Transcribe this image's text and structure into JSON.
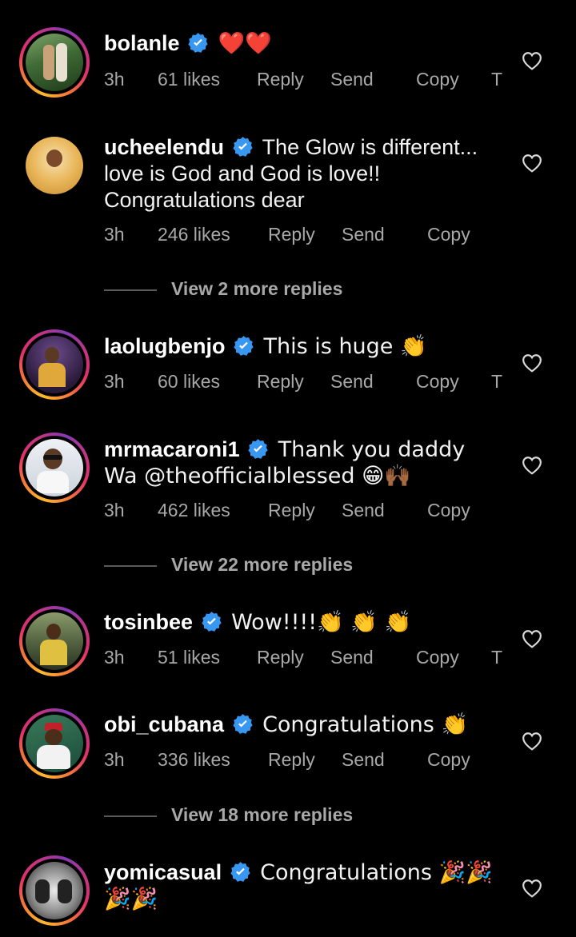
{
  "comments": [
    {
      "username": "bolanle",
      "text": "❤️❤️",
      "time": "3h",
      "likes": "61 likes",
      "reply": "Reply",
      "send": "Send",
      "copy": "Copy",
      "extra": "T",
      "avatar_color": "#2f5a2a"
    },
    {
      "username": "ucheelendu",
      "text": "The Glow is different... love is God and God is love!! Congratulations dear",
      "time": "3h",
      "likes": "246 likes",
      "reply": "Reply",
      "send": "Send",
      "copy": "Copy",
      "avatar_color": "#e0a64a"
    },
    {
      "username": "laolugbenjo",
      "text": "This is huge 👏",
      "time": "3h",
      "likes": "60 likes",
      "reply": "Reply",
      "send": "Send",
      "copy": "Copy",
      "extra": "T",
      "avatar_color": "#3a2b4a"
    },
    {
      "username": "mrmacaroni1",
      "text": "Thank you daddy Wa @theofficialblessed 😁🙌🏾",
      "time": "3h",
      "likes": "462 likes",
      "reply": "Reply",
      "send": "Send",
      "copy": "Copy",
      "avatar_color": "#d8dde6"
    },
    {
      "username": "tosinbee",
      "text": "Wow!!!!👏 👏 👏",
      "time": "3h",
      "likes": "51 likes",
      "reply": "Reply",
      "send": "Send",
      "copy": "Copy",
      "extra": "T",
      "avatar_color": "#4a5a3a"
    },
    {
      "username": "obi_cubana",
      "text": "Congratulations 👏",
      "time": "3h",
      "likes": "336 likes",
      "reply": "Reply",
      "send": "Send",
      "copy": "Copy",
      "avatar_color": "#2a5a4a"
    },
    {
      "username": "yomicasual",
      "text": "Congratulations 🎉🎉 🎉🎉",
      "avatar_color": "#1c1c1c"
    }
  ],
  "view_more": [
    "View 2 more replies",
    "View 22 more replies",
    "View 18 more replies"
  ],
  "colors": {
    "background": "#000000",
    "verified": "#3897f0",
    "meta": "#a8a8a8"
  },
  "icons": {
    "verified": "verified-badge-icon",
    "like": "heart-outline-icon"
  }
}
